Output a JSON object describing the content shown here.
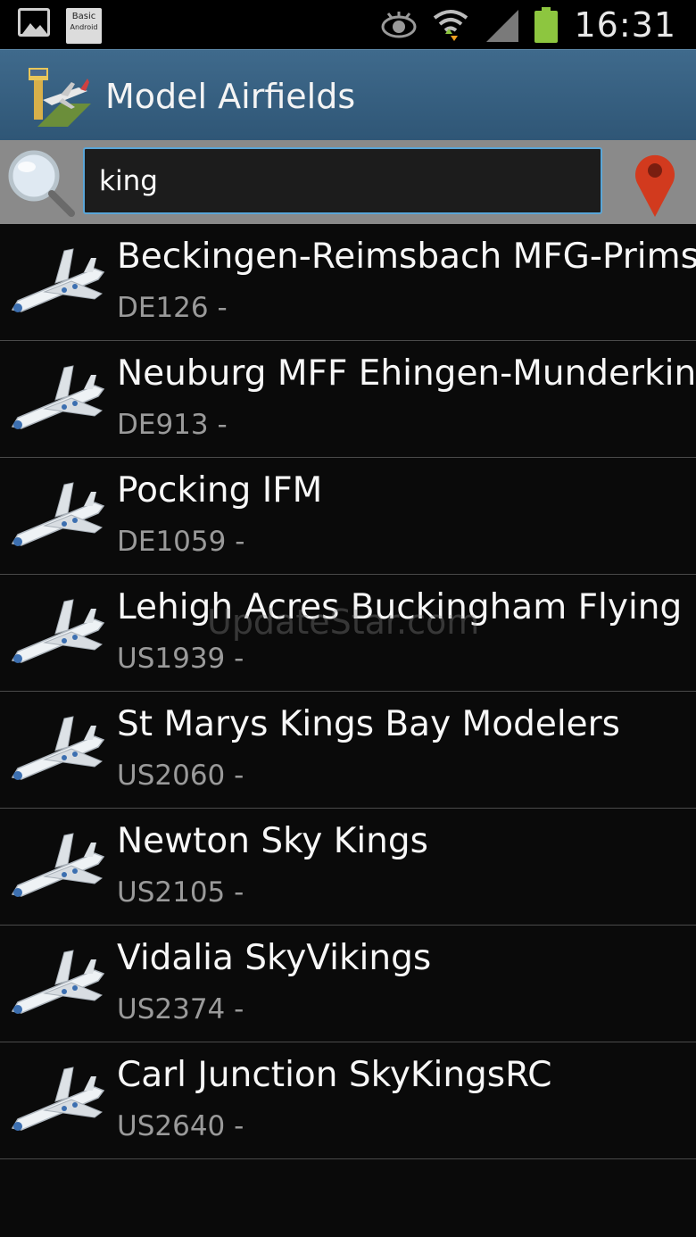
{
  "status_bar": {
    "time": "16:31",
    "notification_icons": [
      "gallery-icon",
      "basic4android-icon"
    ],
    "system_icons": [
      "eye-icon",
      "wifi-icon",
      "signal-icon",
      "battery-icon"
    ],
    "basic_icon_text_top": "Basic",
    "basic_icon_text_bottom": "Android",
    "battery_color": "#8dc63f"
  },
  "action_bar": {
    "title": "Model Airfields",
    "background": "#365f80"
  },
  "search": {
    "value": "king",
    "border_color": "#5aa6d8"
  },
  "results": [
    {
      "title": "Beckingen-Reimsbach MFG-Prims",
      "subtitle": "DE126 -"
    },
    {
      "title": "Neuburg MFF Ehingen-Munderking",
      "subtitle": "DE913 -"
    },
    {
      "title": "Pocking IFM",
      "subtitle": "DE1059 -"
    },
    {
      "title": "Lehigh Acres Buckingham Flying F",
      "subtitle": "US1939 -"
    },
    {
      "title": "St Marys Kings Bay Modelers",
      "subtitle": "US2060 -"
    },
    {
      "title": "Newton Sky Kings",
      "subtitle": "US2105 -"
    },
    {
      "title": "Vidalia SkyVikings",
      "subtitle": "US2374 -"
    },
    {
      "title": "Carl Junction SkyKingsRC",
      "subtitle": "US2640 -"
    }
  ],
  "watermark": "UpdateStar.com"
}
